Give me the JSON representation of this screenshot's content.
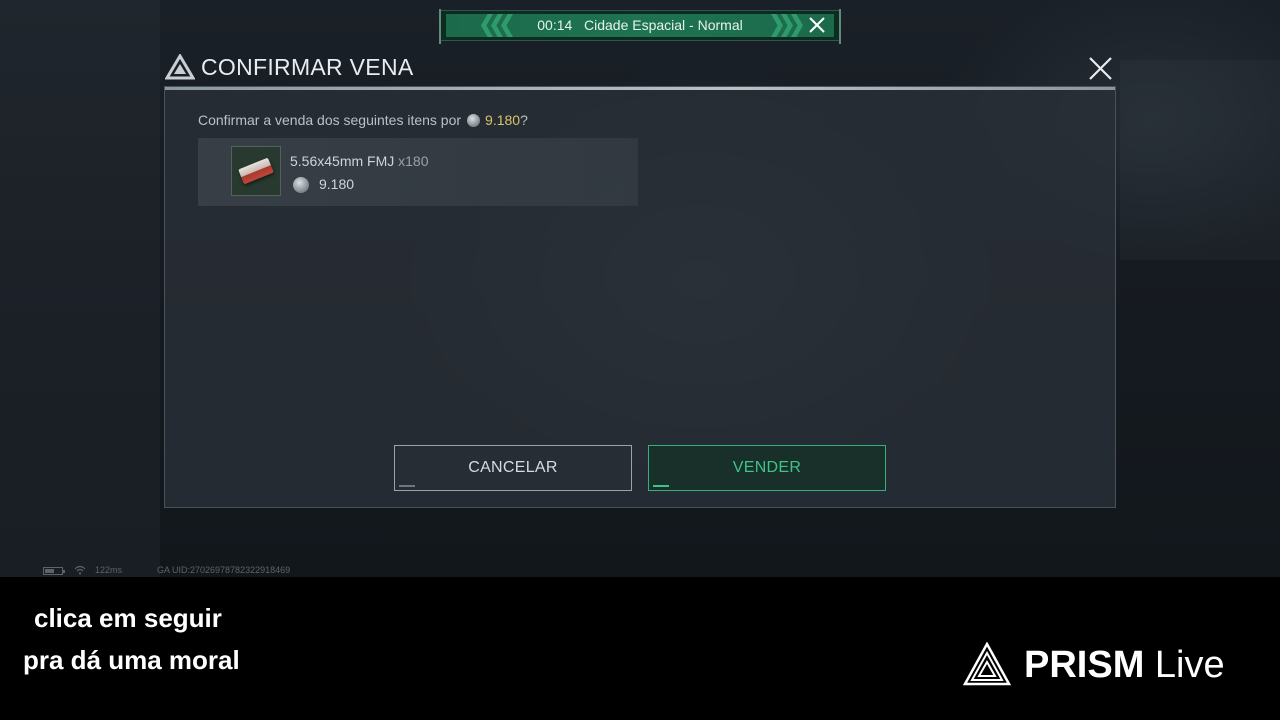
{
  "match_bar": {
    "timer": "00:14",
    "map": "Cidade Espacial - Normal"
  },
  "dialog": {
    "title": "CONFIRMAR VENA",
    "confirm_prefix": "Confirmar a venda dos seguintes itens por",
    "confirm_total": "9.180",
    "confirm_suffix": "?",
    "items": [
      {
        "name": "5.56x45mm FMJ",
        "quantity": "x180",
        "price": "9.180",
        "icon": "ammo-box-icon"
      }
    ],
    "cancel_label": "CANCELAR",
    "sell_label": "VENDER"
  },
  "hud": {
    "ping": "122ms",
    "uid": "GA UID:27026978782322918469"
  },
  "overlay": {
    "line1": "clica em seguir",
    "line2": "pra dá uma moral",
    "brand_bold": "PRISM",
    "brand_light": "Live"
  },
  "colors": {
    "accent_green": "#3dc489",
    "gold": "#d8c36a",
    "match_bar_green": "#1e7352"
  }
}
